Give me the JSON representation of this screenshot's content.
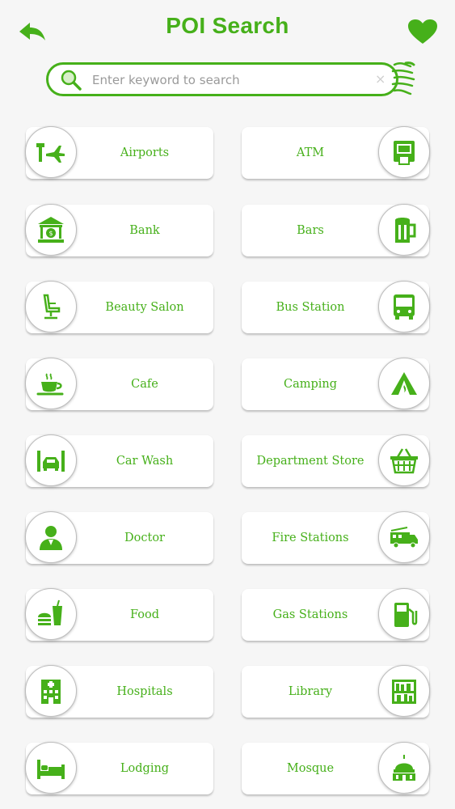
{
  "header": {
    "title": "POI Search"
  },
  "search": {
    "placeholder": "Enter keyword to search",
    "clear_glyph": "×"
  },
  "colors": {
    "accent": "#46b01a",
    "background": "#f6f6f6"
  },
  "categories": [
    {
      "label": "Airports",
      "icon": "airport-icon"
    },
    {
      "label": "ATM",
      "icon": "atm-icon"
    },
    {
      "label": "Bank",
      "icon": "bank-icon"
    },
    {
      "label": "Bars",
      "icon": "beer-mug-icon"
    },
    {
      "label": "Beauty Salon",
      "icon": "salon-chair-icon"
    },
    {
      "label": "Bus Station",
      "icon": "bus-icon"
    },
    {
      "label": "Cafe",
      "icon": "coffee-cup-icon"
    },
    {
      "label": "Camping",
      "icon": "tent-icon"
    },
    {
      "label": "Car Wash",
      "icon": "car-wash-icon"
    },
    {
      "label": "Department Store",
      "icon": "shopping-basket-icon"
    },
    {
      "label": "Doctor",
      "icon": "doctor-icon"
    },
    {
      "label": "Fire Stations",
      "icon": "fire-truck-icon"
    },
    {
      "label": "Food",
      "icon": "fast-food-icon"
    },
    {
      "label": "Gas Stations",
      "icon": "gas-pump-icon"
    },
    {
      "label": "Hospitals",
      "icon": "hospital-icon"
    },
    {
      "label": "Library",
      "icon": "bookshelf-icon"
    },
    {
      "label": "Lodging",
      "icon": "bed-icon"
    },
    {
      "label": "Mosque",
      "icon": "mosque-icon"
    }
  ]
}
